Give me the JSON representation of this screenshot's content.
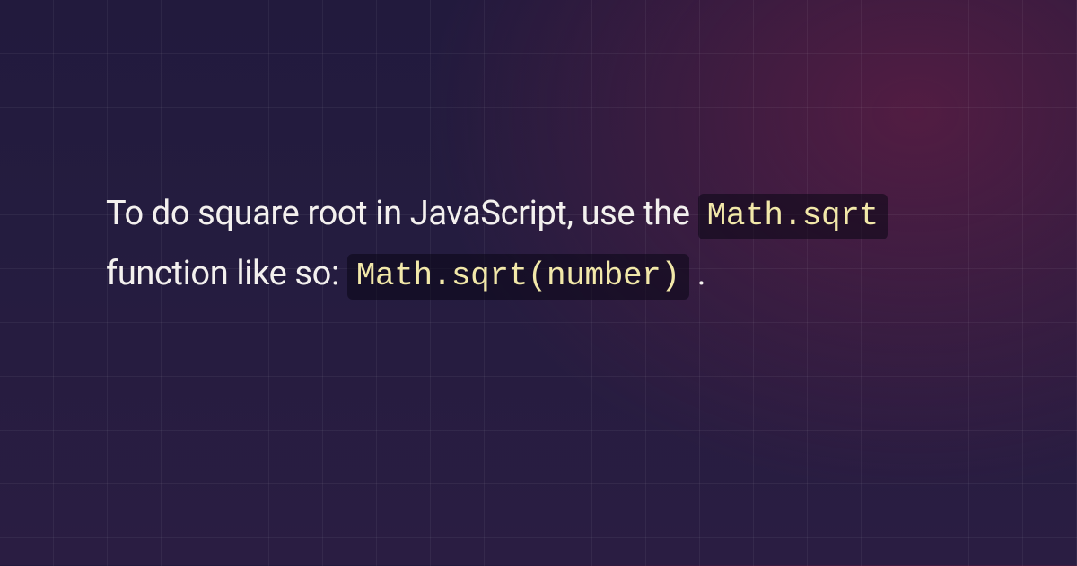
{
  "card": {
    "text1": "To do square root in JavaScript, use the ",
    "code1": "Math.sqrt",
    "text2": " function like so: ",
    "code2": "Math.sqrt(number)",
    "text3": "."
  }
}
